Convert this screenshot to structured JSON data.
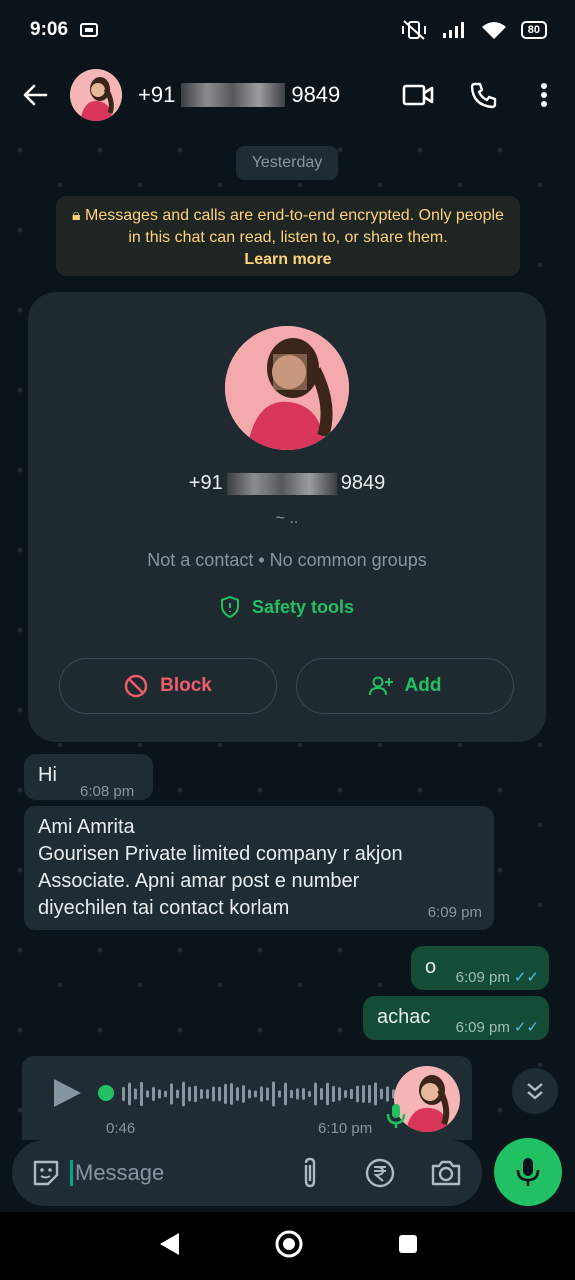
{
  "status_bar": {
    "time": "9:06",
    "battery": "80"
  },
  "header": {
    "number_prefix": "+91",
    "number_suffix": "9849"
  },
  "day_label": "Yesterday",
  "encryption_notice": {
    "text": "Messages and calls are end-to-end encrypted. Only people in this chat can read, listen to, or share them.",
    "link": "Learn more"
  },
  "profile_card": {
    "number_prefix": "+91",
    "number_suffix": "9849",
    "about": "~ ..",
    "info": "Not a contact • No common groups",
    "safety": "Safety tools",
    "block": "Block",
    "add": "Add"
  },
  "messages": [
    {
      "text": "Hi",
      "time": "6:08 pm"
    },
    {
      "line1": "Ami Amrita",
      "line2": "Gourisen Private limited company r akjon",
      "line3": "Associate. Apni amar post e number",
      "line4": "diyechilen tai contact korlam",
      "time": "6:09 pm"
    },
    {
      "text": "o",
      "time": "6:09 pm"
    },
    {
      "text": "achac",
      "time": "6:09 pm"
    }
  ],
  "voice_note": {
    "duration": "0:46",
    "time": "6:10 pm",
    "progress": 0.0
  },
  "composer": {
    "placeholder": "Message"
  },
  "colors": {
    "accent": "#21c063",
    "bubble_out": "#144d37",
    "bubble_in": "#202c33",
    "block_red": "#f15c6d",
    "notice": "#ffd279"
  }
}
